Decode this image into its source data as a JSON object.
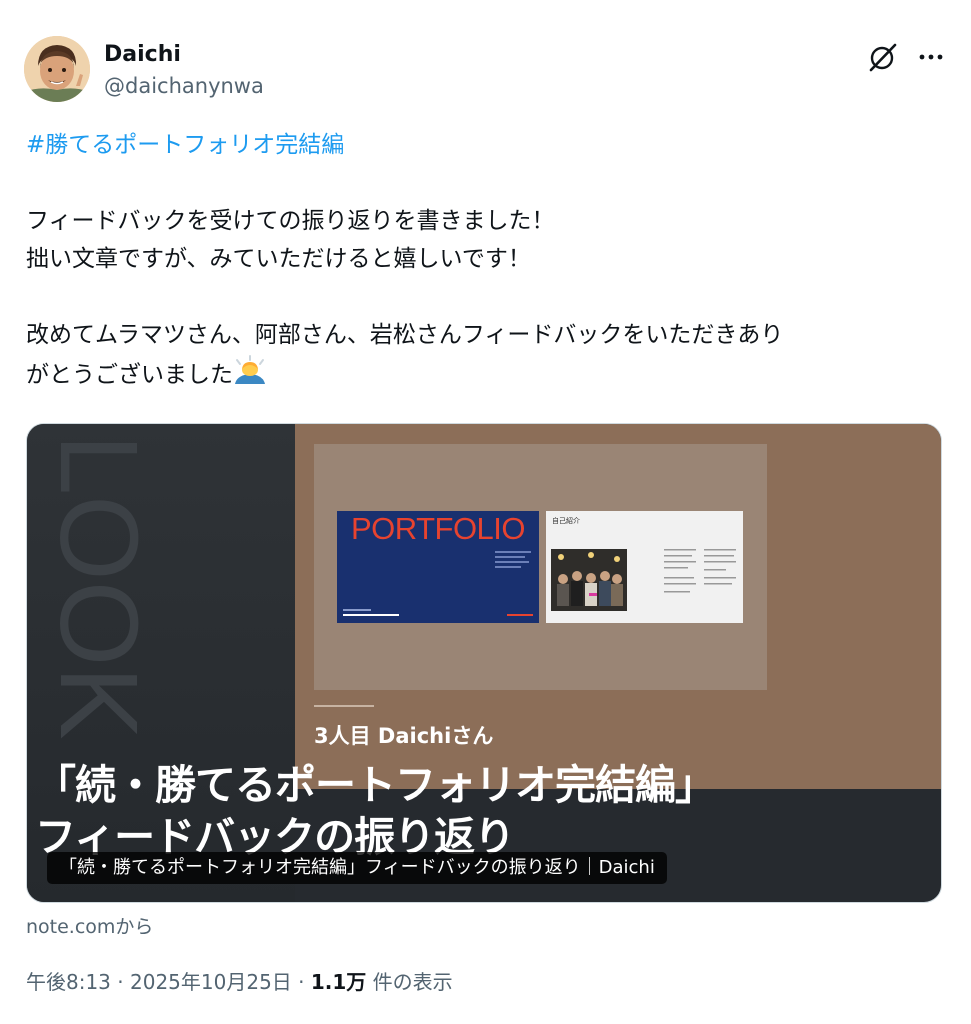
{
  "author": {
    "name": "Daichi",
    "handle": "@daichanynwa"
  },
  "tweet": {
    "hashtag": "#勝てるポートフォリオ完結編",
    "line1": "フィードバックを受けての振り返りを書きました！",
    "line2": "拙い文章ですが、みていただけると嬉しいです！",
    "line3": "改めてムラマツさん、阿部さん、岩松さんフィードバックをいただきあり",
    "line4": "がとうございました",
    "emoji": "person-bowing-emoji"
  },
  "card": {
    "portfolio_title": "PORTFOLIO",
    "intro_title": "自己紹介",
    "person_label": "3人目 Daichiさん",
    "big_title_line1": "「続・勝てるポートフォリオ完結編」",
    "big_title_line2": "フィードバックの振り返り",
    "caption": "「続・勝てるポートフォリオ完結編」フィードバックの振り返り｜Daichi",
    "bg_left": "#2f3337",
    "bg_right": "#8c6e58",
    "portfolio_bg": "#19306f",
    "portfolio_text": "#e7432f"
  },
  "source_label": "note.comから",
  "meta": {
    "time": "午後8:13",
    "separator": "·",
    "date": "2025年10月25日",
    "views": "1.1万",
    "views_label": "件の表示"
  },
  "colors": {
    "text": "#0f1419",
    "secondary": "#536471",
    "link": "#1d9bf0"
  }
}
